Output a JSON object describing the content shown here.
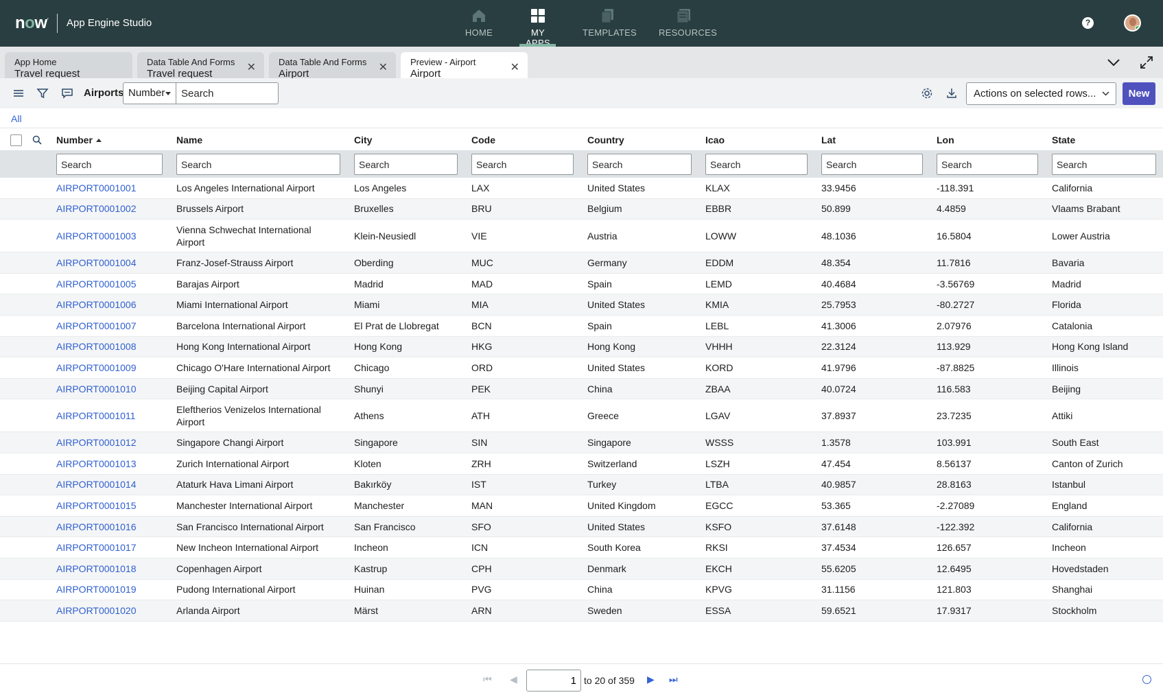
{
  "header": {
    "logo": "now",
    "app_title": "App Engine Studio",
    "nav": [
      {
        "label": "HOME",
        "icon": "home-icon"
      },
      {
        "label": "MY APPS",
        "icon": "grid-icon",
        "active": true
      },
      {
        "label": "TEMPLATES",
        "icon": "templates-icon"
      },
      {
        "label": "RESOURCES",
        "icon": "resources-icon"
      }
    ],
    "help": "?"
  },
  "tabs": [
    {
      "title": "App Home",
      "subtitle": "Travel request",
      "closable": false
    },
    {
      "title": "Data Table And Forms",
      "subtitle": "Travel request",
      "closable": true
    },
    {
      "title": "Data Table And Forms",
      "subtitle": "Airport",
      "closable": true
    },
    {
      "title": "Preview - Airport",
      "subtitle": "Airport",
      "closable": true,
      "active": true
    }
  ],
  "toolbar": {
    "list_title": "Airports",
    "field_select": "Number",
    "search_placeholder": "Search",
    "actions_select": "Actions on selected rows...",
    "new_label": "New"
  },
  "breadcrumb": "All",
  "columns": [
    "Number",
    "Name",
    "City",
    "Code",
    "Country",
    "Icao",
    "Lat",
    "Lon",
    "State"
  ],
  "column_filter_placeholder": "Search",
  "rows": [
    [
      "AIRPORT0001001",
      "Los Angeles International Airport",
      "Los Angeles",
      "LAX",
      "United States",
      "KLAX",
      "33.9456",
      "-118.391",
      "California"
    ],
    [
      "AIRPORT0001002",
      "Brussels Airport",
      "Bruxelles",
      "BRU",
      "Belgium",
      "EBBR",
      "50.899",
      "4.4859",
      "Vlaams Brabant"
    ],
    [
      "AIRPORT0001003",
      "Vienna Schwechat International Airport",
      "Klein-Neusiedl",
      "VIE",
      "Austria",
      "LOWW",
      "48.1036",
      "16.5804",
      "Lower Austria"
    ],
    [
      "AIRPORT0001004",
      "Franz-Josef-Strauss Airport",
      "Oberding",
      "MUC",
      "Germany",
      "EDDM",
      "48.354",
      "11.7816",
      "Bavaria"
    ],
    [
      "AIRPORT0001005",
      "Barajas Airport",
      "Madrid",
      "MAD",
      "Spain",
      "LEMD",
      "40.4684",
      "-3.56769",
      "Madrid"
    ],
    [
      "AIRPORT0001006",
      "Miami International Airport",
      "Miami",
      "MIA",
      "United States",
      "KMIA",
      "25.7953",
      "-80.2727",
      "Florida"
    ],
    [
      "AIRPORT0001007",
      "Barcelona International Airport",
      "El Prat de Llobregat",
      "BCN",
      "Spain",
      "LEBL",
      "41.3006",
      "2.07976",
      "Catalonia"
    ],
    [
      "AIRPORT0001008",
      "Hong Kong International Airport",
      "Hong Kong",
      "HKG",
      "Hong Kong",
      "VHHH",
      "22.3124",
      "113.929",
      "Hong Kong Island"
    ],
    [
      "AIRPORT0001009",
      "Chicago O'Hare International Airport",
      "Chicago",
      "ORD",
      "United States",
      "KORD",
      "41.9796",
      "-87.8825",
      "Illinois"
    ],
    [
      "AIRPORT0001010",
      "Beijing Capital Airport",
      "Shunyi",
      "PEK",
      "China",
      "ZBAA",
      "40.0724",
      "116.583",
      "Beijing"
    ],
    [
      "AIRPORT0001011",
      "Eleftherios Venizelos International Airport",
      "Athens",
      "ATH",
      "Greece",
      "LGAV",
      "37.8937",
      "23.7235",
      "Attiki"
    ],
    [
      "AIRPORT0001012",
      "Singapore Changi Airport",
      "Singapore",
      "SIN",
      "Singapore",
      "WSSS",
      "1.3578",
      "103.991",
      "South East"
    ],
    [
      "AIRPORT0001013",
      "Zurich International Airport",
      "Kloten",
      "ZRH",
      "Switzerland",
      "LSZH",
      "47.454",
      "8.56137",
      "Canton of Zurich"
    ],
    [
      "AIRPORT0001014",
      "Ataturk Hava Limani Airport",
      "Bakırköy",
      "IST",
      "Turkey",
      "LTBA",
      "40.9857",
      "28.8163",
      "Istanbul"
    ],
    [
      "AIRPORT0001015",
      "Manchester International Airport",
      "Manchester",
      "MAN",
      "United Kingdom",
      "EGCC",
      "53.365",
      "-2.27089",
      "England"
    ],
    [
      "AIRPORT0001016",
      "San Francisco International Airport",
      "San Francisco",
      "SFO",
      "United States",
      "KSFO",
      "37.6148",
      "-122.392",
      "California"
    ],
    [
      "AIRPORT0001017",
      "New Incheon International Airport",
      "Incheon",
      "ICN",
      "South Korea",
      "RKSI",
      "37.4534",
      "126.657",
      "Incheon"
    ],
    [
      "AIRPORT0001018",
      "Copenhagen Airport",
      "Kastrup",
      "CPH",
      "Denmark",
      "EKCH",
      "55.6205",
      "12.6495",
      "Hovedstaden"
    ],
    [
      "AIRPORT0001019",
      "Pudong International Airport",
      "Huinan",
      "PVG",
      "China",
      "KPVG",
      "31.1156",
      "121.803",
      "Shanghai"
    ],
    [
      "AIRPORT0001020",
      "Arlanda Airport",
      "Märst",
      "ARN",
      "Sweden",
      "ESSA",
      "59.6521",
      "17.9317",
      "Stockholm"
    ]
  ],
  "pagination": {
    "current_page": "1",
    "range_text": "to 20 of 359"
  },
  "colors": {
    "header_bg": "#293e40",
    "accent_green": "#81b5a1",
    "link_blue": "#2f5fd0",
    "primary_button": "#4f52bd"
  }
}
